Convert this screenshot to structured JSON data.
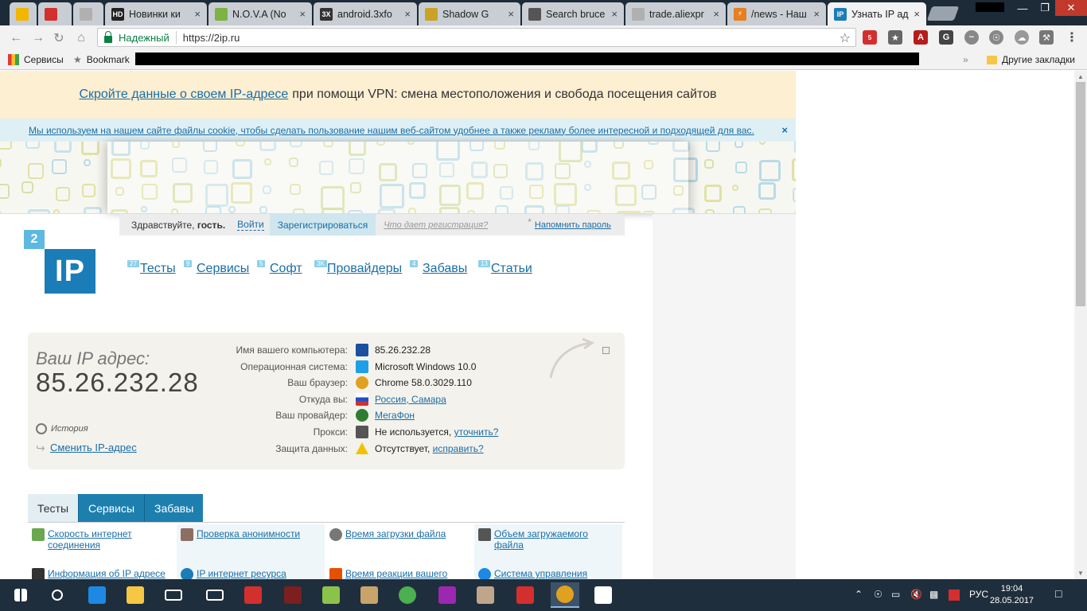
{
  "browser": {
    "tabs": [
      {
        "title": "",
        "fav_color": "#f2b600",
        "fav_text": ""
      },
      {
        "title": "",
        "fav_color": "#d32f2f",
        "fav_text": ""
      },
      {
        "title": "",
        "fav_color": "#b0b0b0",
        "fav_text": ""
      },
      {
        "title": "Новинки ки",
        "fav_color": "#222222",
        "fav_text": "HD"
      },
      {
        "title": "N.O.V.A (No",
        "fav_color": "#7cb342",
        "fav_text": ""
      },
      {
        "title": "android.3xfo",
        "fav_color": "#333333",
        "fav_text": "3X"
      },
      {
        "title": "Shadow G",
        "fav_color": "#c9a227",
        "fav_text": ""
      },
      {
        "title": "Search bruce",
        "fav_color": "#555555",
        "fav_text": ""
      },
      {
        "title": "trade.aliexpr",
        "fav_color": "#b0b0b0",
        "fav_text": ""
      },
      {
        "title": "/news - Наш",
        "fav_color": "#e67e22",
        "fav_text": "⚡"
      },
      {
        "title": "Узнать IP ад",
        "fav_color": "#1b7db7",
        "fav_text": "IP"
      }
    ],
    "secure_label": "Надежный",
    "url": "https://2ip.ru",
    "bookmarks": {
      "apps": "Сервисы",
      "bookmark": "Bookmark",
      "other": "Другие закладки",
      "chevron": "»"
    },
    "ext_badge": "5"
  },
  "page": {
    "vpn": {
      "link": "Скройте данные о своем IP-адресе",
      "text": "при помощи VPN: смена местоположения и свобода посещения сайтов"
    },
    "cookie": {
      "text": "Мы используем на нашем сайте файлы cookie, чтобы сделать пользование нашим веб-сайтом удобнее а также рекламу более интересной и подходящей для вас.",
      "close": "×"
    },
    "login": {
      "hello": "Здравствуйте,",
      "guest": "гость.",
      "login": "Войти",
      "register": "Зарегистрироваться",
      "why": "Что дает регистрация?",
      "star": "*",
      "remind": "Напомнить пароль"
    },
    "logo": {
      "two": "2",
      "ip": "IP"
    },
    "menu": [
      {
        "label": "Тесты",
        "count": "27"
      },
      {
        "label": "Сервисы",
        "count": "9"
      },
      {
        "label": "Софт",
        "count": "5"
      },
      {
        "label": "Провайдеры",
        "count": "3K"
      },
      {
        "label": "Забавы",
        "count": "4"
      },
      {
        "label": "Статьи",
        "count": "13"
      }
    ],
    "ipbox": {
      "label": "Ваш IP адрес:",
      "ip": "85.26.232.28",
      "history": "История",
      "change": "Сменить IP-адрес",
      "rows": [
        {
          "k": "Имя вашего компьютера:",
          "v": "85.26.232.28",
          "link": "",
          "suffix": "",
          "icon": "computer-icon",
          "icon_color": "#1b4fa0"
        },
        {
          "k": "Операционная система:",
          "v": "Microsoft Windows 10.0",
          "link": "",
          "suffix": "",
          "icon": "windows-icon",
          "icon_color": "#1ea0e8"
        },
        {
          "k": "Ваш браузер:",
          "v": "Chrome 58.0.3029.110",
          "link": "",
          "suffix": "",
          "icon": "chrome-icon",
          "icon_color": "#e0a020"
        },
        {
          "k": "Откуда вы:",
          "v": "",
          "link": "Россия, Самара",
          "suffix": "",
          "icon": "russia-flag-icon",
          "icon_color": "#c62828"
        },
        {
          "k": "Ваш провайдер:",
          "v": "",
          "link": "МегаФон",
          "suffix": "",
          "icon": "megafon-icon",
          "icon_color": "#2e7d32"
        },
        {
          "k": "Прокси:",
          "v": "Не используется,",
          "link": "уточнить?",
          "suffix": "",
          "icon": "glasses-icon",
          "icon_color": "#555555"
        },
        {
          "k": "Защита данных:",
          "v": "Отсутствует,",
          "link": "исправить?",
          "suffix": "",
          "icon": "warning-icon",
          "icon_color": "#f2c200"
        }
      ]
    },
    "tabs": [
      {
        "label": "Тесты",
        "active": true
      },
      {
        "label": "Сервисы",
        "active": false
      },
      {
        "label": "Забавы",
        "active": false
      }
    ],
    "tests": [
      {
        "label": "Скорость интернет соединения",
        "icon": "speed-icon",
        "color": "#6aa84f"
      },
      {
        "label": "Проверка анонимности",
        "icon": "anonymous-icon",
        "color": "#8d6e63"
      },
      {
        "label": "Время загрузки файла",
        "icon": "clock-icon",
        "color": "#777777"
      },
      {
        "label": "Объем загружаемого файла",
        "icon": "file-size-icon",
        "color": "#555555"
      },
      {
        "label": "Информация об IP адресе",
        "icon": "ip-info-icon",
        "color": "#333333"
      },
      {
        "label": "IP интернет ресурса",
        "icon": "ip-resource-icon",
        "color": "#1b7db7"
      },
      {
        "label": "Время реакции вашего",
        "icon": "reaction-icon",
        "color": "#e65100"
      },
      {
        "label": "Система управления",
        "icon": "cms-icon",
        "color": "#1e88e5"
      }
    ]
  },
  "taskbar": {
    "lang": "РУС",
    "time": "19:04",
    "date": "28.05.2017"
  }
}
